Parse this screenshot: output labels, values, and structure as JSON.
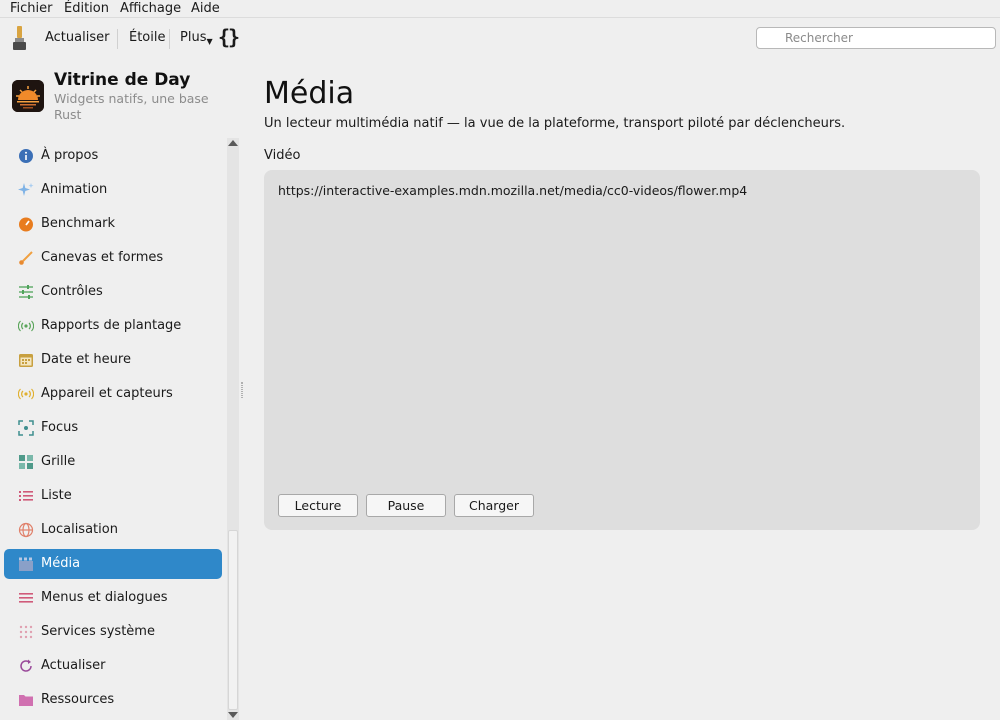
{
  "menubar": {
    "items": [
      "Fichier",
      "Édition",
      "Affichage",
      "Aide"
    ]
  },
  "toolbar": {
    "refresh_label": "Actualiser",
    "star_label": "Étoile",
    "more_label": "Plus",
    "braces_label": "{}",
    "search_placeholder": "Rechercher"
  },
  "app": {
    "title": "Vitrine de Day",
    "subtitle": "Widgets natifs, une base Rust"
  },
  "sidebar": {
    "items": [
      {
        "label": "À propos",
        "icon": "info-icon",
        "color": "#3b6fb6"
      },
      {
        "label": "Animation",
        "icon": "sparkle-icon",
        "color": "#7fb3e6"
      },
      {
        "label": "Benchmark",
        "icon": "gauge-icon",
        "color": "#e87c1e"
      },
      {
        "label": "Canevas et formes",
        "icon": "brush-icon",
        "color": "#f0a040"
      },
      {
        "label": "Contrôles",
        "icon": "sliders-icon",
        "color": "#4fa35a"
      },
      {
        "label": "Rapports de plantage",
        "icon": "broadcast-icon",
        "color": "#5aa55a"
      },
      {
        "label": "Date et heure",
        "icon": "calendar-icon",
        "color": "#c8a040"
      },
      {
        "label": "Appareil et capteurs",
        "icon": "sensor-icon",
        "color": "#e0b030"
      },
      {
        "label": "Focus",
        "icon": "focus-icon",
        "color": "#3f8f8f"
      },
      {
        "label": "Grille",
        "icon": "grid-icon",
        "color": "#4f9a8a"
      },
      {
        "label": "Liste",
        "icon": "list-icon",
        "color": "#d05a7a"
      },
      {
        "label": "Localisation",
        "icon": "globe-icon",
        "color": "#e0806a"
      },
      {
        "label": "Média",
        "icon": "clapper-icon",
        "color": "#8aa0c8"
      },
      {
        "label": "Menus et dialogues",
        "icon": "menu-icon",
        "color": "#d05a7a"
      },
      {
        "label": "Services système",
        "icon": "dots-grid-icon",
        "color": "#e0a0b0"
      },
      {
        "label": "Actualiser",
        "icon": "refresh-icon",
        "color": "#9a4a9a"
      },
      {
        "label": "Ressources",
        "icon": "folder-icon",
        "color": "#d070b0"
      }
    ],
    "selected": "Média",
    "selected_color": "#2f88c9"
  },
  "main": {
    "title": "Média",
    "description": "Un lecteur multimédia natif — la vue de la plateforme, transport piloté par déclencheurs.",
    "section_label": "Vidéo",
    "video_url": "https://interactive-examples.mdn.mozilla.net/media/cc0-videos/flower.mp4",
    "buttons": {
      "play": "Lecture",
      "pause": "Pause",
      "load": "Charger"
    }
  }
}
